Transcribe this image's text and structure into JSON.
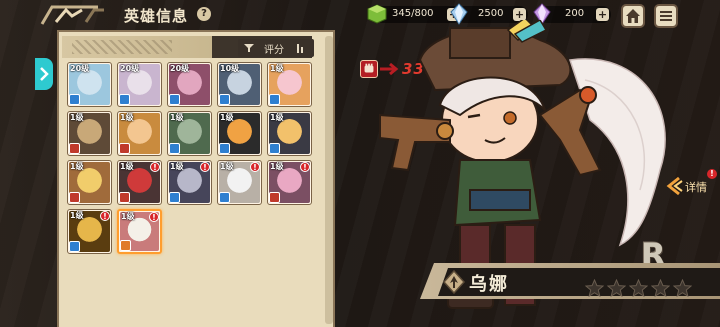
{
  "header": {
    "title": "英雄信息",
    "help_label": "?"
  },
  "resources": [
    {
      "name": "stamina",
      "icon": "green-cube-icon",
      "value": "345/800",
      "color": "#8cc63f"
    },
    {
      "name": "crystal",
      "icon": "blue-crystal-icon",
      "value": "2500",
      "color": "#7fb6e6"
    },
    {
      "name": "gem",
      "icon": "purple-crystal-icon",
      "value": "200",
      "color": "#b07ad6"
    }
  ],
  "plus_label": "+",
  "sort": {
    "label": "评分"
  },
  "heroes": [
    {
      "level": "20级",
      "palette": [
        "#cfe3ef",
        "#9cc7de"
      ],
      "class_color": "#2e7fd0",
      "stars": "",
      "alert": false,
      "selected": false
    },
    {
      "level": "20级",
      "palette": [
        "#e9e0ea",
        "#c9b5cf"
      ],
      "class_color": "#2e7fd0",
      "stars": "",
      "alert": false,
      "selected": false
    },
    {
      "level": "20级",
      "palette": [
        "#e2a6bf",
        "#8e4f6a"
      ],
      "class_color": "#2e7fd0",
      "stars": "",
      "alert": false,
      "selected": false
    },
    {
      "level": "10级",
      "palette": [
        "#c7d3e0",
        "#4f5f74"
      ],
      "class_color": "#2e7fd0",
      "stars": "",
      "alert": false,
      "selected": false
    },
    {
      "level": "1级",
      "palette": [
        "#f6c6cf",
        "#e6a25e"
      ],
      "class_color": "#2e7fd0",
      "stars": "",
      "alert": false,
      "selected": false
    },
    {
      "level": "1级",
      "palette": [
        "#c8a878",
        "#5e4a37"
      ],
      "class_color": "#c0392b",
      "stars": "",
      "alert": false,
      "selected": false
    },
    {
      "level": "1级",
      "palette": [
        "#f3c690",
        "#c98b3e"
      ],
      "class_color": "#c0392b",
      "stars": "",
      "alert": false,
      "selected": false
    },
    {
      "level": "1级",
      "palette": [
        "#9fb59a",
        "#4f6a4e"
      ],
      "class_color": "#2e7fd0",
      "stars": "",
      "alert": false,
      "selected": false
    },
    {
      "level": "1级",
      "palette": [
        "#f0a243",
        "#2b2b2b"
      ],
      "class_color": "#2e7fd0",
      "stars": "",
      "alert": false,
      "selected": false
    },
    {
      "level": "1级",
      "palette": [
        "#f2c16b",
        "#3a3a44"
      ],
      "class_color": "#2e7fd0",
      "stars": "",
      "alert": false,
      "selected": false
    },
    {
      "level": "1级",
      "palette": [
        "#f1cd6b",
        "#a06b3b"
      ],
      "class_color": "#c0392b",
      "stars": "",
      "alert": false,
      "selected": false
    },
    {
      "level": "1级",
      "palette": [
        "#cf3a3a",
        "#4a3434"
      ],
      "class_color": "#c0392b",
      "stars": "",
      "alert": true,
      "selected": false
    },
    {
      "level": "1级",
      "palette": [
        "#b7b7c9",
        "#46455a"
      ],
      "class_color": "#2e7fd0",
      "stars": "",
      "alert": true,
      "selected": false
    },
    {
      "level": "1级",
      "palette": [
        "#f2f2f2",
        "#b8b0a6"
      ],
      "class_color": "#2e7fd0",
      "stars": "",
      "alert": true,
      "selected": false
    },
    {
      "level": "1级",
      "palette": [
        "#e9a8c3",
        "#7b4f63"
      ],
      "class_color": "#c0392b",
      "stars": "",
      "alert": true,
      "selected": false
    },
    {
      "level": "1级",
      "palette": [
        "#e6b64a",
        "#5a3d10"
      ],
      "class_color": "#2e7fd0",
      "stars": "",
      "alert": true,
      "selected": false
    },
    {
      "level": "1级",
      "palette": [
        "#f4f0e8",
        "#c97b7b"
      ],
      "class_color": "#e07b2a",
      "stars": "",
      "alert": true,
      "selected": true
    }
  ],
  "hero": {
    "power": "339",
    "detail_label": "详情",
    "detail_alert": "!",
    "rarity": "R",
    "name": "乌娜",
    "star_count": 5,
    "accent": "#ff9d2e"
  }
}
